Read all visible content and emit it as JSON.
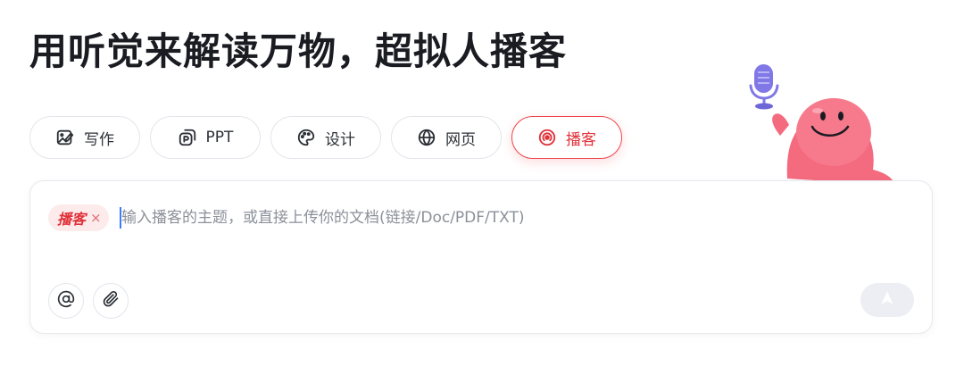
{
  "headline": "用听觉来解读万物，超拟人播客",
  "tabs": [
    {
      "label": "写作",
      "icon": "write-icon",
      "active": false
    },
    {
      "label": "PPT",
      "icon": "ppt-icon",
      "active": false
    },
    {
      "label": "设计",
      "icon": "palette-icon",
      "active": false
    },
    {
      "label": "网页",
      "icon": "globe-icon",
      "active": false
    },
    {
      "label": "播客",
      "icon": "podcast-icon",
      "active": true
    }
  ],
  "composer": {
    "chip_label": "播客",
    "chip_close": "×",
    "placeholder": "输入播客的主题，或直接上传你的文档(链接/Doc/PDF/TXT)",
    "value": ""
  },
  "colors": {
    "accent": "#f0444c",
    "chip_bg": "#fdebec",
    "send_bg": "#eceef3",
    "mascot": "#f46a7f",
    "mic": "#7f78e6"
  }
}
